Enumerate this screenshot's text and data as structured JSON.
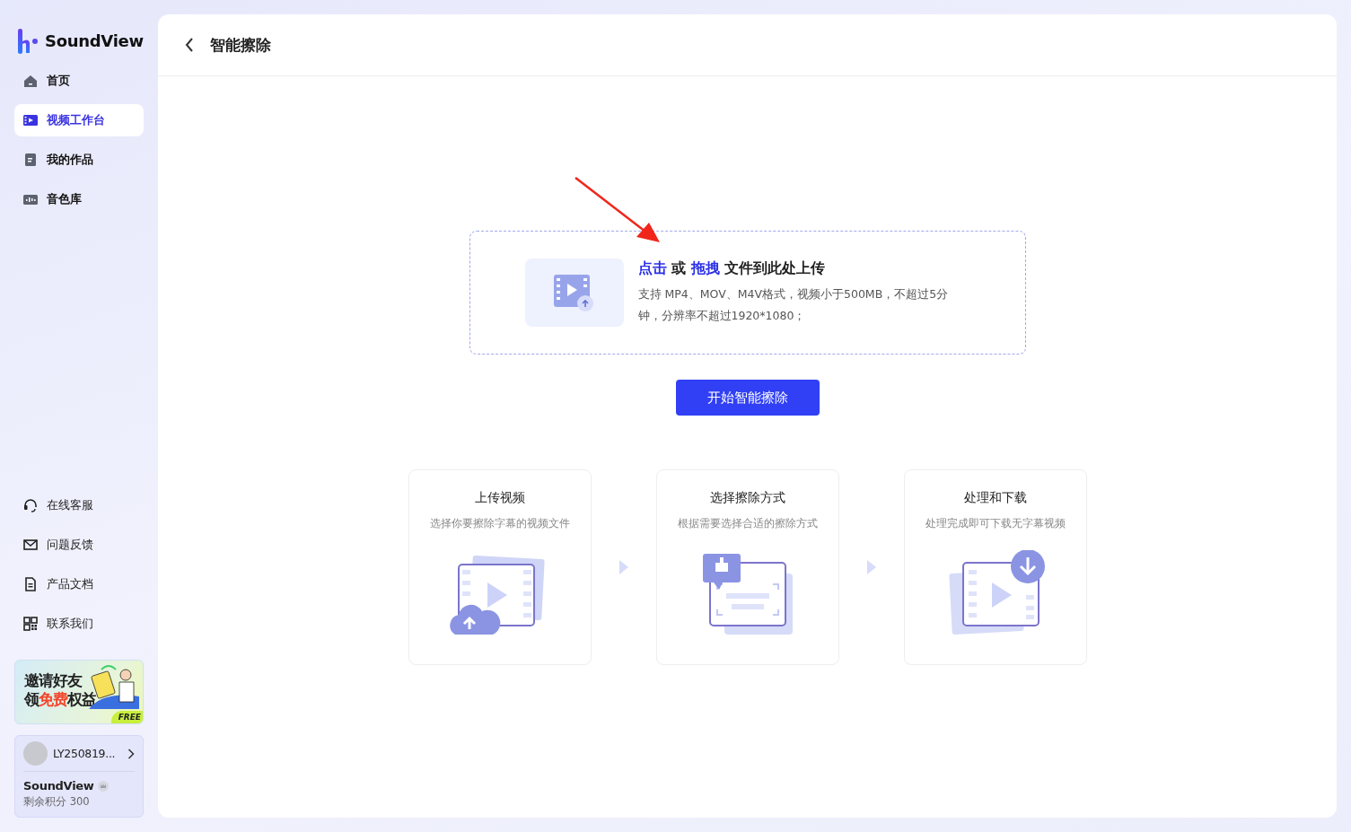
{
  "brand": {
    "name": "SoundView"
  },
  "nav": [
    {
      "label": "首页",
      "kind": "home",
      "selected": false
    },
    {
      "label": "视频工作台",
      "kind": "film",
      "selected": true
    },
    {
      "label": "我的作品",
      "kind": "doc",
      "selected": false
    },
    {
      "label": "音色库",
      "kind": "wave",
      "selected": false
    }
  ],
  "links": [
    {
      "label": "在线客服",
      "kind": "headset"
    },
    {
      "label": "问题反馈",
      "kind": "mail"
    },
    {
      "label": "产品文档",
      "kind": "file"
    },
    {
      "label": "联系我们",
      "kind": "qr"
    }
  ],
  "promo": {
    "line1": "邀请好友",
    "line2_parts": [
      {
        "text": "领",
        "highlight": false
      },
      {
        "text": "免费",
        "highlight": true
      },
      {
        "text": "权益",
        "highlight": false
      }
    ],
    "badge": "FREE"
  },
  "account": {
    "user": "LY250819...",
    "product": "SoundView",
    "credits": "剩余积分 300"
  },
  "page": {
    "title": "智能擦除"
  },
  "upload": {
    "title_parts": [
      {
        "text": "点击",
        "highlight": true
      },
      {
        "text": " 或 ",
        "highlight": false
      },
      {
        "text": "拖拽",
        "highlight": true
      },
      {
        "text": " 文件到此处上传",
        "highlight": false
      }
    ],
    "hint": "支持 MP4、MOV、M4V格式，视频小于500MB，不超过5分钟，分辨率不超过1920*1080；"
  },
  "start_button": "开始智能擦除",
  "steps": [
    {
      "title": "上传视频",
      "desc": "选择你要擦除字幕的视频文件",
      "kind": "upload"
    },
    {
      "title": "选择擦除方式",
      "desc": "根据需要选择合适的擦除方式",
      "kind": "erase"
    },
    {
      "title": "处理和下载",
      "desc": "处理完成即可下载无字幕视频",
      "kind": "download"
    }
  ]
}
